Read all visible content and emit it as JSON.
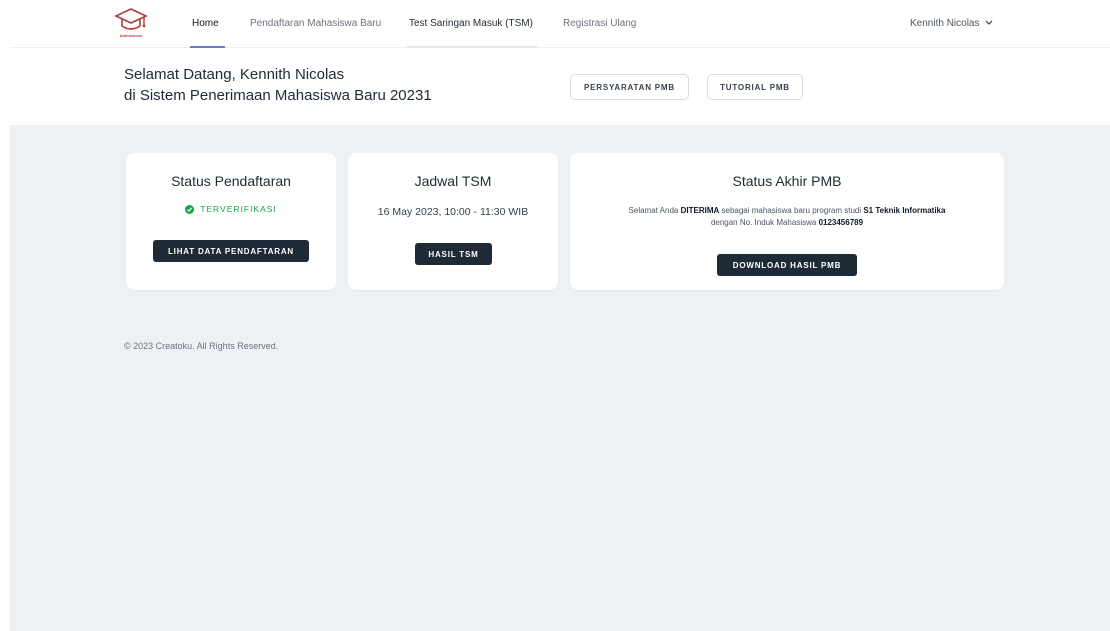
{
  "brand": {
    "logo_text": "Admissions"
  },
  "nav": {
    "items": [
      {
        "label": "Home"
      },
      {
        "label": "Pendaftaran Mahasiswa Baru"
      },
      {
        "label": "Test Saringan Masuk (TSM)"
      },
      {
        "label": "Registrasi Ulang"
      }
    ],
    "user": "Kennith Nicolas"
  },
  "header": {
    "line1": "Selamat Datang, Kennith Nicolas",
    "line2": "di Sistem Penerimaan Mahasiswa Baru 20231",
    "btn_requirements": "PERSYARATAN PMB",
    "btn_tutorial": "TUTORIAL PMB"
  },
  "cards": {
    "status": {
      "title": "Status Pendaftaran",
      "state": "TERVERIFIKASI",
      "button": "LIHAT DATA PENDAFTARAN"
    },
    "schedule": {
      "title": "Jadwal TSM",
      "datetime": "16 May 2023, 10:00 - 11:30 WIB",
      "button": "HASIL TSM"
    },
    "final": {
      "title": "Status Akhir PMB",
      "msg_a": "Selamat Anda ",
      "msg_b": "DITERIMA",
      "msg_c": " sebagai mahasiswa baru program studi ",
      "msg_d": "S1 Teknik Informatika",
      "msg_e": "dengan No. Induk Mahasiswa ",
      "msg_f": "0123456789",
      "button": "DOWNLOAD HASIL PMB"
    }
  },
  "footer": "© 2023 Creatoku. All Rights Reserved.",
  "colors": {
    "brand": "#b33a3a",
    "accent_underline": "#6b7bd8",
    "success": "#16a34a",
    "dark_button": "#1f2a37",
    "background": "#eef1f4"
  },
  "icons": {
    "logo": "graduation-cap-icon",
    "user_chevron": "chevron-down-icon",
    "status": "check-circle-icon"
  }
}
